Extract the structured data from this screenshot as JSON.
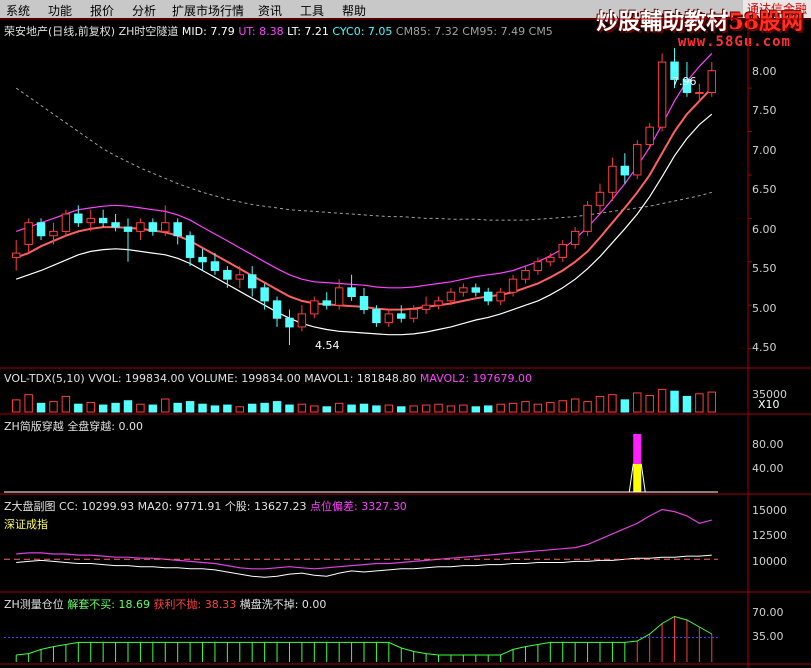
{
  "menu": [
    "系统",
    "功能",
    "报价",
    "分析",
    "扩展市场行情",
    "资讯",
    "工具",
    "帮助"
  ],
  "notice": "通达信金融",
  "watermark": {
    "title_a": "炒股輔助教材",
    "title_b": "58股网",
    "url": "www.58Gu.com"
  },
  "main": {
    "security": "荣安地产(日线,前复权)",
    "indicator": "ZH时空隧道",
    "mid": "MID: 7.79",
    "ut": "UT: 8.38",
    "lt": "LT: 7.21",
    "cyc": "CYC0: 7.05",
    "cm85": "CM85: 7.32",
    "cm95": "CM95: 7.49",
    "cm5": "CM5",
    "high_label": "7.96",
    "low_label": "4.54",
    "y_ticks": [
      "8.00",
      "7.50",
      "7.00",
      "6.50",
      "6.00",
      "5.50",
      "5.00",
      "4.50"
    ]
  },
  "vol": {
    "name": "VOL-TDX(5,10)",
    "vvol": "VVOL: 199834.00",
    "volume": "VOLUME: 199834.00",
    "mavol1": "MAVOL1: 181848.80",
    "mavol2": "MAVOL2: 197679.00",
    "y_tick": "35000",
    "unit": "X10"
  },
  "cross": {
    "title": "ZH简版穿越",
    "value": "全盘穿越: 0.00",
    "y_ticks": [
      "80.00",
      "40.00"
    ]
  },
  "market": {
    "title": "Z大盘副图",
    "cc": "CC: 10299.93",
    "ma20": "MA20: 9771.91",
    "stock": "个股: 13627.23",
    "dev_label": "点位偏差: ",
    "dev_value": "3327.30",
    "index_name": "深证成指",
    "y_ticks": [
      "15000",
      "12500",
      "10000"
    ]
  },
  "position": {
    "title": "ZH测量仓位",
    "a": "解套不买: 18.69",
    "b": "获利不抛: 38.33",
    "c": "横盘洗不掉: 0.00",
    "y_ticks": [
      "70.00",
      "35.00"
    ]
  },
  "colors": {
    "up": "#ff3c3c",
    "down": "#54ffff",
    "mid": "#ffffff",
    "ut": "#ff40ff",
    "lt": "#ffffff",
    "grid": "#a00000"
  },
  "chart_data": {
    "type": "candlestick",
    "ylim": [
      4.3,
      8.1
    ],
    "candles": [
      [
        5.55,
        5.75,
        5.4,
        5.6
      ],
      [
        5.7,
        6.0,
        5.6,
        5.95
      ],
      [
        5.95,
        6.0,
        5.75,
        5.8
      ],
      [
        5.8,
        5.95,
        5.7,
        5.85
      ],
      [
        5.85,
        6.1,
        5.8,
        6.05
      ],
      [
        6.05,
        6.15,
        5.9,
        5.95
      ],
      [
        5.95,
        6.1,
        5.85,
        6.0
      ],
      [
        6.0,
        6.1,
        5.9,
        5.95
      ],
      [
        5.95,
        6.05,
        5.85,
        5.9
      ],
      [
        5.9,
        6.0,
        5.5,
        5.85
      ],
      [
        5.85,
        6.0,
        5.75,
        5.95
      ],
      [
        5.95,
        6.0,
        5.8,
        5.85
      ],
      [
        5.85,
        6.15,
        5.8,
        5.95
      ],
      [
        5.95,
        6.0,
        5.7,
        5.8
      ],
      [
        5.8,
        5.85,
        5.45,
        5.55
      ],
      [
        5.55,
        5.65,
        5.4,
        5.5
      ],
      [
        5.5,
        5.6,
        5.35,
        5.4
      ],
      [
        5.4,
        5.45,
        5.2,
        5.3
      ],
      [
        5.3,
        5.45,
        5.2,
        5.35
      ],
      [
        5.35,
        5.45,
        5.1,
        5.2
      ],
      [
        5.2,
        5.25,
        4.95,
        5.05
      ],
      [
        5.05,
        5.1,
        4.75,
        4.85
      ],
      [
        4.85,
        4.95,
        4.54,
        4.75
      ],
      [
        4.75,
        5.0,
        4.7,
        4.9
      ],
      [
        4.9,
        5.1,
        4.85,
        5.05
      ],
      [
        5.05,
        5.15,
        4.95,
        5.0
      ],
      [
        5.0,
        5.3,
        4.95,
        5.2
      ],
      [
        5.2,
        5.35,
        5.05,
        5.1
      ],
      [
        5.1,
        5.2,
        4.9,
        4.95
      ],
      [
        4.95,
        5.0,
        4.75,
        4.8
      ],
      [
        4.8,
        4.95,
        4.75,
        4.9
      ],
      [
        4.9,
        5.0,
        4.8,
        4.85
      ],
      [
        4.85,
        5.0,
        4.8,
        4.95
      ],
      [
        4.95,
        5.1,
        4.9,
        5.0
      ],
      [
        5.0,
        5.1,
        4.95,
        5.05
      ],
      [
        5.05,
        5.2,
        5.0,
        5.15
      ],
      [
        5.15,
        5.25,
        5.1,
        5.2
      ],
      [
        5.2,
        5.25,
        5.1,
        5.15
      ],
      [
        5.15,
        5.2,
        5.0,
        5.05
      ],
      [
        5.05,
        5.2,
        5.0,
        5.15
      ],
      [
        5.15,
        5.35,
        5.1,
        5.3
      ],
      [
        5.3,
        5.45,
        5.25,
        5.4
      ],
      [
        5.4,
        5.55,
        5.35,
        5.5
      ],
      [
        5.5,
        5.6,
        5.45,
        5.55
      ],
      [
        5.55,
        5.75,
        5.5,
        5.7
      ],
      [
        5.7,
        5.9,
        5.65,
        5.85
      ],
      [
        5.85,
        6.2,
        5.8,
        6.15
      ],
      [
        6.15,
        6.4,
        6.05,
        6.3
      ],
      [
        6.3,
        6.7,
        6.2,
        6.6
      ],
      [
        6.6,
        6.75,
        6.4,
        6.5
      ],
      [
        6.5,
        6.9,
        6.45,
        6.85
      ],
      [
        6.85,
        7.1,
        6.8,
        7.05
      ],
      [
        7.05,
        7.9,
        7.0,
        7.8
      ],
      [
        7.8,
        7.96,
        7.5,
        7.6
      ],
      [
        7.6,
        7.8,
        7.4,
        7.45
      ],
      [
        7.45,
        7.55,
        7.35,
        7.45
      ],
      [
        7.45,
        7.8,
        7.4,
        7.7
      ]
    ],
    "volumes": [
      14,
      20,
      10,
      12,
      18,
      9,
      11,
      8,
      10,
      13,
      9,
      8,
      15,
      10,
      12,
      9,
      7,
      8,
      6,
      9,
      10,
      12,
      8,
      9,
      7,
      6,
      10,
      8,
      9,
      7,
      8,
      6,
      7,
      8,
      9,
      7,
      8,
      6,
      7,
      9,
      10,
      12,
      9,
      11,
      13,
      15,
      12,
      18,
      20,
      14,
      22,
      19,
      26,
      24,
      18,
      21,
      23
    ],
    "mid": [
      5.55,
      5.6,
      5.68,
      5.74,
      5.8,
      5.85,
      5.88,
      5.9,
      5.9,
      5.89,
      5.88,
      5.86,
      5.84,
      5.8,
      5.74,
      5.66,
      5.58,
      5.5,
      5.42,
      5.34,
      5.26,
      5.18,
      5.1,
      5.05,
      5.02,
      5.01,
      5.0,
      4.99,
      4.98,
      4.96,
      4.95,
      4.95,
      4.96,
      4.98,
      5.0,
      5.02,
      5.05,
      5.08,
      5.1,
      5.12,
      5.15,
      5.2,
      5.25,
      5.32,
      5.4,
      5.5,
      5.62,
      5.78,
      5.95,
      6.12,
      6.3,
      6.5,
      6.75,
      7.0,
      7.2,
      7.35,
      7.5
    ],
    "ut": [
      5.85,
      5.9,
      5.95,
      6.0,
      6.05,
      6.1,
      6.12,
      6.14,
      6.15,
      6.14,
      6.12,
      6.1,
      6.08,
      6.04,
      5.98,
      5.9,
      5.82,
      5.74,
      5.66,
      5.58,
      5.5,
      5.42,
      5.35,
      5.3,
      5.27,
      5.26,
      5.25,
      5.24,
      5.23,
      5.21,
      5.2,
      5.2,
      5.21,
      5.23,
      5.25,
      5.27,
      5.3,
      5.33,
      5.35,
      5.37,
      5.4,
      5.45,
      5.5,
      5.57,
      5.65,
      5.76,
      5.9,
      6.05,
      6.22,
      6.4,
      6.6,
      6.82,
      7.08,
      7.35,
      7.58,
      7.75,
      7.9
    ],
    "lt": [
      5.3,
      5.35,
      5.4,
      5.46,
      5.52,
      5.58,
      5.62,
      5.64,
      5.65,
      5.64,
      5.62,
      5.6,
      5.58,
      5.54,
      5.48,
      5.4,
      5.32,
      5.24,
      5.16,
      5.08,
      5.0,
      4.92,
      4.85,
      4.79,
      4.75,
      4.72,
      4.7,
      4.69,
      4.68,
      4.67,
      4.66,
      4.66,
      4.67,
      4.69,
      4.72,
      4.75,
      4.79,
      4.83,
      4.86,
      4.9,
      4.95,
      5.0,
      5.05,
      5.12,
      5.2,
      5.3,
      5.42,
      5.56,
      5.72,
      5.88,
      6.05,
      6.25,
      6.48,
      6.72,
      6.92,
      7.08,
      7.2
    ],
    "dash_upper": [
      7.5,
      7.4,
      7.3,
      7.2,
      7.1,
      7.0,
      6.9,
      6.8,
      6.72,
      6.65,
      6.58,
      6.52,
      6.46,
      6.4,
      6.35,
      6.3,
      6.26,
      6.22,
      6.19,
      6.16,
      6.14,
      6.12,
      6.1,
      6.09,
      6.08,
      6.07,
      6.06,
      6.05,
      6.04,
      6.03,
      6.02,
      6.02,
      6.01,
      6.0,
      6.0,
      5.99,
      5.99,
      5.99,
      5.98,
      5.98,
      5.98,
      5.98,
      5.99,
      6.0,
      6.01,
      6.02,
      6.04,
      6.06,
      6.08,
      6.1,
      6.12,
      6.14,
      6.17,
      6.2,
      6.23,
      6.26,
      6.3
    ],
    "market_cc": [
      9.6,
      9.7,
      9.8,
      9.7,
      9.6,
      9.5,
      9.5,
      9.4,
      9.3,
      9.3,
      9.2,
      9.2,
      9.1,
      9.1,
      9.0,
      9.0,
      8.9,
      8.7,
      8.5,
      8.3,
      8.2,
      8.3,
      8.5,
      8.6,
      8.4,
      8.3,
      8.6,
      8.8,
      8.7,
      8.8,
      8.9,
      9.0,
      9.0,
      9.1,
      9.2,
      9.2,
      9.3,
      9.3,
      9.4,
      9.4,
      9.5,
      9.5,
      9.6,
      9.6,
      9.6,
      9.7,
      9.7,
      9.8,
      9.8,
      9.9,
      10.0,
      10.0,
      10.1,
      10.1,
      10.2,
      10.2,
      10.3
    ],
    "market_stock": [
      10.4,
      10.5,
      10.5,
      10.4,
      10.4,
      10.3,
      10.3,
      10.2,
      10.1,
      10.1,
      10.0,
      10.0,
      9.9,
      9.8,
      9.7,
      9.6,
      9.5,
      9.3,
      9.1,
      9.0,
      9.0,
      9.1,
      9.2,
      9.1,
      9.0,
      9.1,
      9.2,
      9.3,
      9.4,
      9.5,
      9.5,
      9.6,
      9.7,
      9.8,
      9.9,
      10.0,
      10.1,
      10.2,
      10.3,
      10.4,
      10.5,
      10.6,
      10.7,
      10.8,
      10.9,
      11.0,
      11.3,
      11.8,
      12.3,
      12.8,
      13.3,
      14.0,
      14.6,
      14.4,
      14.0,
      13.3,
      13.6
    ],
    "position_values": [
      10,
      12,
      18,
      22,
      25,
      28,
      28,
      28,
      28,
      28,
      28,
      28,
      28,
      28,
      28,
      28,
      28,
      28,
      28,
      28,
      28,
      28,
      28,
      28,
      28,
      28,
      28,
      28,
      28,
      28,
      28,
      20,
      15,
      12,
      10,
      10,
      10,
      10,
      10,
      10,
      18,
      22,
      25,
      28,
      28,
      28,
      28,
      28,
      28,
      28,
      30,
      40,
      55,
      65,
      60,
      50,
      40
    ]
  }
}
